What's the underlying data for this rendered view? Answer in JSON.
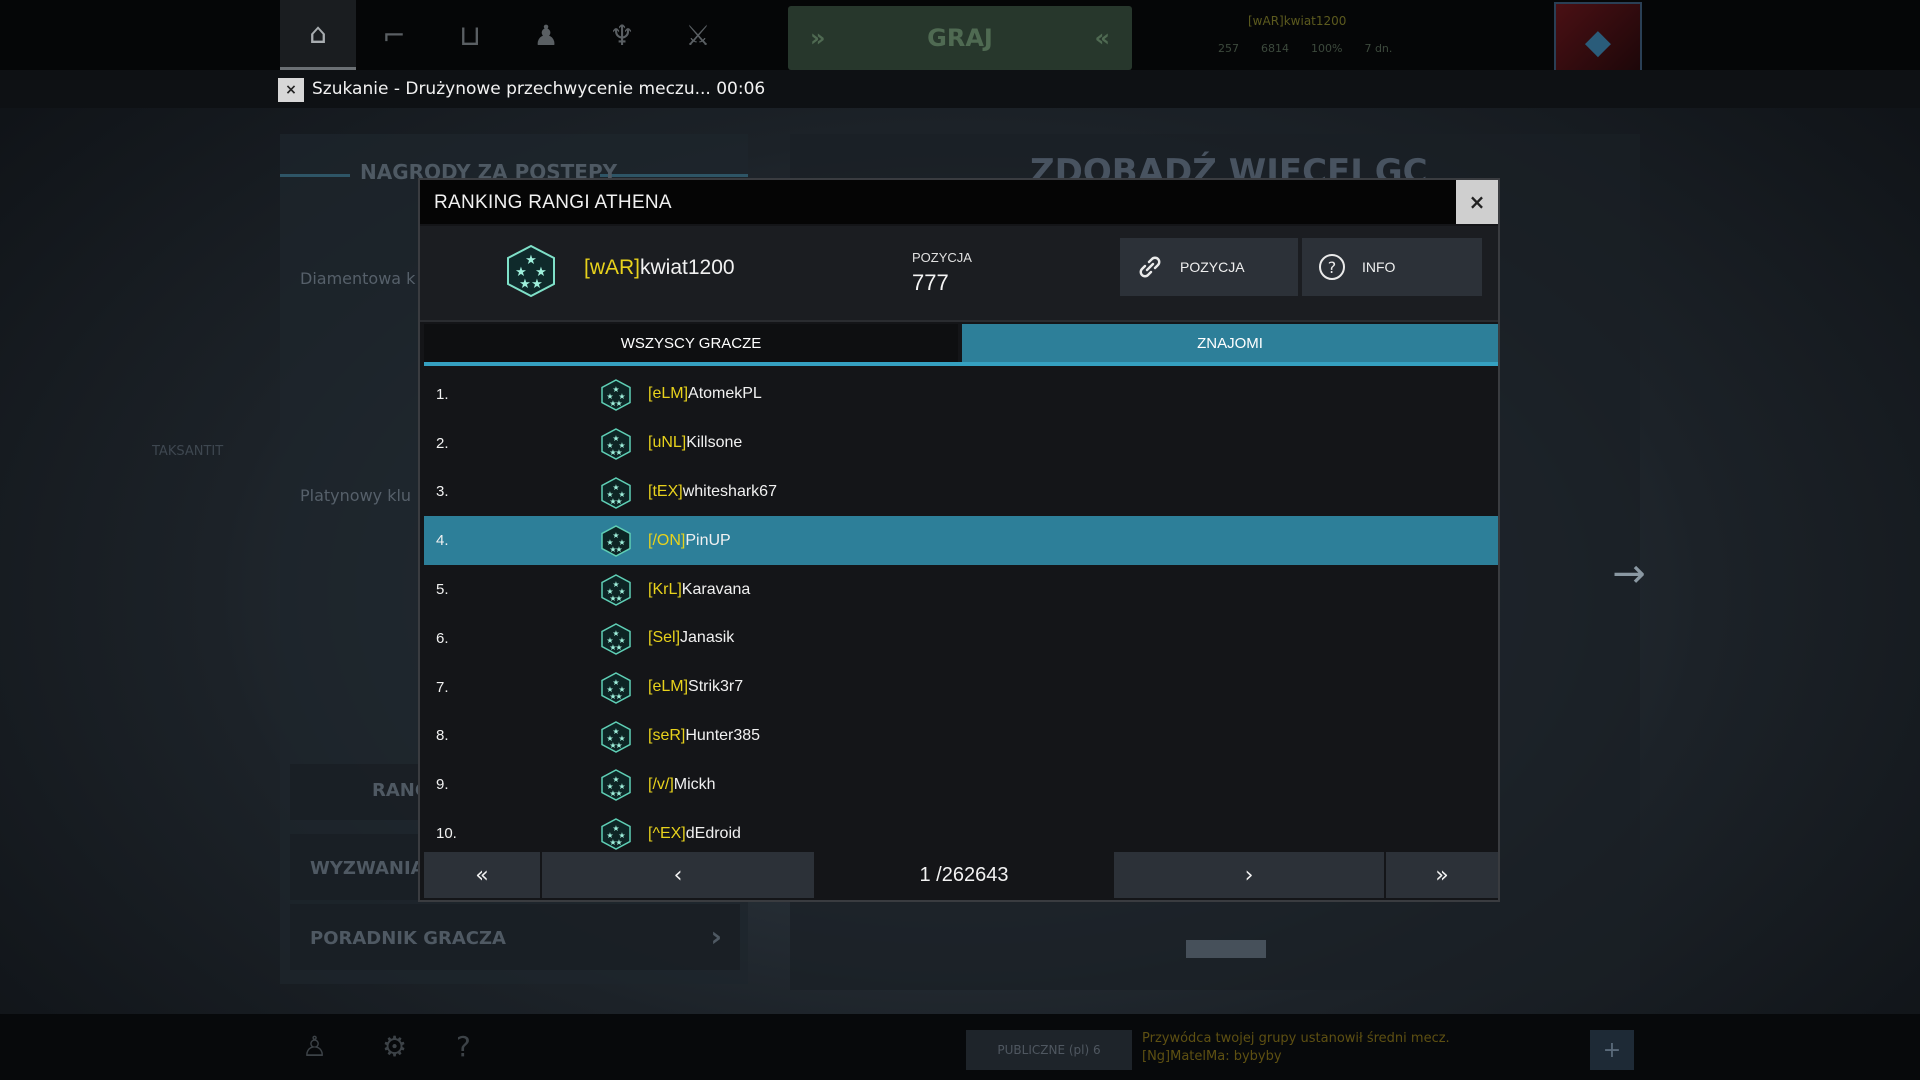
{
  "topbar": {
    "nav": [
      {
        "name": "home-icon",
        "glyph": "⌂"
      },
      {
        "name": "weapons-icon",
        "glyph": "⌐"
      },
      {
        "name": "shop-icon",
        "glyph": "⊔"
      },
      {
        "name": "profile-icon",
        "glyph": "♟"
      },
      {
        "name": "trophy-icon",
        "glyph": "♆"
      },
      {
        "name": "clan-icon",
        "glyph": "⚔"
      }
    ],
    "play_label": "GRAJ",
    "player_name": "[wAR]kwiat1200",
    "stats": [
      "257",
      "6814",
      "100%",
      "7 dn."
    ]
  },
  "search": {
    "close_label": "×",
    "text": "Szukanie - Drużynowe przechwycenie meczu... 00:06"
  },
  "background": {
    "left_title": "NAGRODY ZA POSTĘPY",
    "left_a": "Diamentowa k",
    "left_b": "Platynowy klu",
    "left_c": "TAKSANTIT",
    "rank_label": "RANG",
    "challenges_label": "WYZWANIA",
    "guide_label": "PORADNIK GRACZA",
    "right_title": "ZDOBĄDŹ WIĘCEJ GC",
    "public_label": "PUBLICZNE (pl) 6",
    "chat_line1": "Przywódca twojej grupy ustanowił średni mecz.",
    "chat_line2": "[Ng]MatelMa: bybyby"
  },
  "modal": {
    "title": "RANKING RANGI ATHENA",
    "close_label": "×",
    "player": {
      "tag": "[wAR]",
      "name": "kwiat1200"
    },
    "position_label": "POZYCJA",
    "position_value": "777",
    "position_button": "POZYCJA",
    "info_button": "INFO",
    "tabs": {
      "all": "WSZYSCY GRACZE",
      "friends": "ZNAJOMI"
    },
    "rows": [
      {
        "rank": "1.",
        "tag": "[eLM]",
        "name": "AtomekPL"
      },
      {
        "rank": "2.",
        "tag": "[uNL]",
        "name": "Killsone"
      },
      {
        "rank": "3.",
        "tag": "[tEX]",
        "name": "whiteshark67"
      },
      {
        "rank": "4.",
        "tag": "[/ON]",
        "name": "PinUP"
      },
      {
        "rank": "5.",
        "tag": "[KrL]",
        "name": "Karavana"
      },
      {
        "rank": "6.",
        "tag": "[Sel]",
        "name": "Janasik"
      },
      {
        "rank": "7.",
        "tag": "[eLM]",
        "name": "Strik3r7"
      },
      {
        "rank": "8.",
        "tag": "[seR]",
        "name": "Hunter385"
      },
      {
        "rank": "9.",
        "tag": "[/v/]",
        "name": "Mickh"
      },
      {
        "rank": "10.",
        "tag": "[^EX]",
        "name": "dEdroid"
      }
    ],
    "selected_row": 3,
    "pager": {
      "first": "«",
      "prev": "‹",
      "info": "1 /262643",
      "next": "›",
      "last": "»"
    }
  },
  "colors": {
    "accent": "#2d7f99",
    "clan_tag": "#e8d21c",
    "rank_icon": "#7fe0c8"
  }
}
